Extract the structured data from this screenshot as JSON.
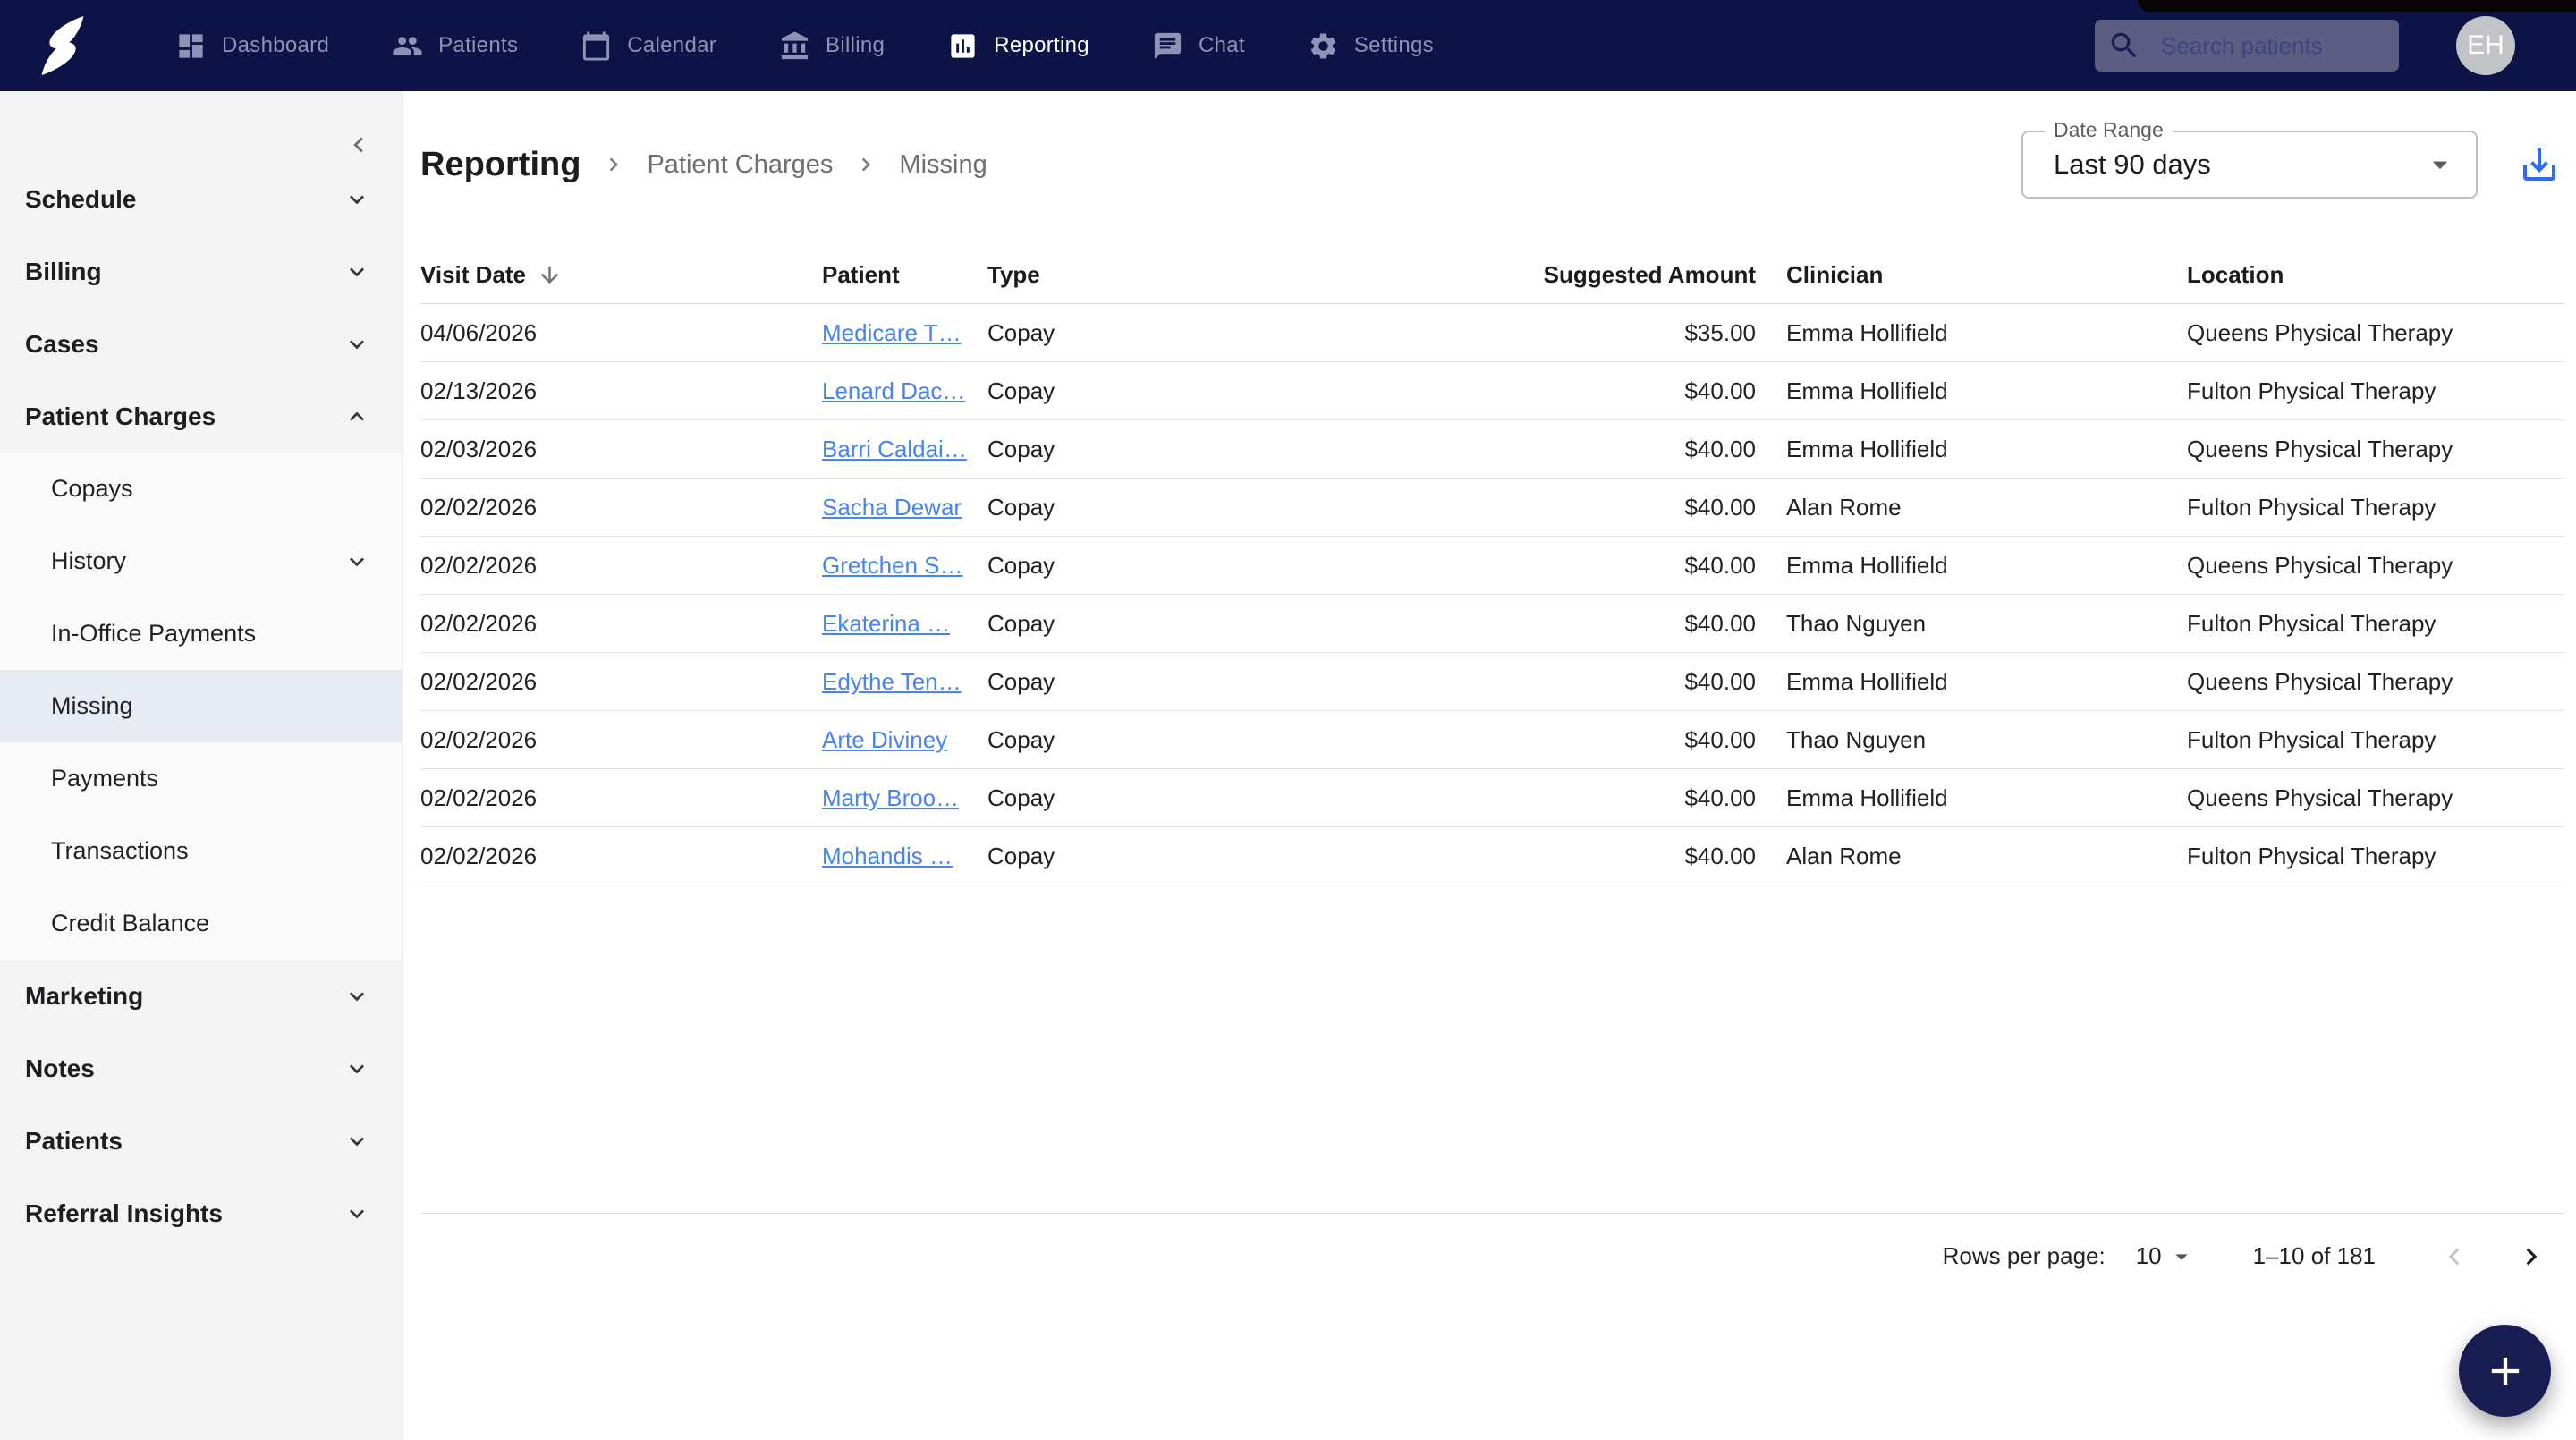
{
  "colors": {
    "navbar-bg": "#0e1347",
    "link-blue": "#4683f4",
    "download-blue": "#2a6cf5",
    "fab-bg": "#191e52",
    "selected-bg": "#e7ebf3"
  },
  "app": {
    "logo_name": "brand-s-logo",
    "nav": [
      {
        "label": "Dashboard",
        "icon": "dashboard-icon",
        "active": false
      },
      {
        "label": "Patients",
        "icon": "patients-icon",
        "active": false
      },
      {
        "label": "Calendar",
        "icon": "calendar-icon",
        "active": false
      },
      {
        "label": "Billing",
        "icon": "billing-icon",
        "active": false
      },
      {
        "label": "Reporting",
        "icon": "reporting-icon",
        "active": true
      },
      {
        "label": "Chat",
        "icon": "chat-icon",
        "active": false
      },
      {
        "label": "Settings",
        "icon": "settings-icon",
        "active": false
      }
    ],
    "search_placeholder": "Search patients",
    "avatar_initials": "EH"
  },
  "sidebar": {
    "items": [
      {
        "label": "Schedule",
        "type": "top",
        "chevron": "down"
      },
      {
        "label": "Billing",
        "type": "top",
        "chevron": "down"
      },
      {
        "label": "Cases",
        "type": "top",
        "chevron": "down"
      },
      {
        "label": "Patient Charges",
        "type": "top",
        "chevron": "up"
      },
      {
        "label": "Copays",
        "type": "sub",
        "chevron": ""
      },
      {
        "label": "History",
        "type": "sub",
        "chevron": "down"
      },
      {
        "label": "In-Office Payments",
        "type": "sub",
        "chevron": ""
      },
      {
        "label": "Missing",
        "type": "sub",
        "chevron": "",
        "selected": true
      },
      {
        "label": "Payments",
        "type": "sub",
        "chevron": ""
      },
      {
        "label": "Transactions",
        "type": "sub",
        "chevron": ""
      },
      {
        "label": "Credit Balance",
        "type": "sub",
        "chevron": ""
      },
      {
        "label": "Marketing",
        "type": "top",
        "chevron": "down"
      },
      {
        "label": "Notes",
        "type": "top",
        "chevron": "down"
      },
      {
        "label": "Patients",
        "type": "top",
        "chevron": "down"
      },
      {
        "label": "Referral Insights",
        "type": "top",
        "chevron": "down"
      }
    ]
  },
  "breadcrumb": [
    "Reporting",
    "Patient Charges",
    "Missing"
  ],
  "toolbar": {
    "date_range_label": "Date Range",
    "date_range_value": "Last 90 days"
  },
  "table": {
    "columns": [
      "Visit Date",
      "Patient",
      "Type",
      "Suggested Amount",
      "Clinician",
      "Location"
    ],
    "sorted_column": "Visit Date",
    "sort_direction": "desc",
    "rows": [
      {
        "visit_date": "04/06/2026",
        "patient": "Medicare T…",
        "type": "Copay",
        "amount": "$35.00",
        "clinician": "Emma Hollifield",
        "location": "Queens Physical Therapy"
      },
      {
        "visit_date": "02/13/2026",
        "patient": "Lenard Dac…",
        "type": "Copay",
        "amount": "$40.00",
        "clinician": "Emma Hollifield",
        "location": "Fulton Physical Therapy"
      },
      {
        "visit_date": "02/03/2026",
        "patient": "Barri Caldai…",
        "type": "Copay",
        "amount": "$40.00",
        "clinician": "Emma Hollifield",
        "location": "Queens Physical Therapy"
      },
      {
        "visit_date": "02/02/2026",
        "patient": "Sacha Dewar",
        "type": "Copay",
        "amount": "$40.00",
        "clinician": "Alan Rome",
        "location": "Fulton Physical Therapy"
      },
      {
        "visit_date": "02/02/2026",
        "patient": "Gretchen S…",
        "type": "Copay",
        "amount": "$40.00",
        "clinician": "Emma Hollifield",
        "location": "Queens Physical Therapy"
      },
      {
        "visit_date": "02/02/2026",
        "patient": "Ekaterina …",
        "type": "Copay",
        "amount": "$40.00",
        "clinician": "Thao Nguyen",
        "location": "Fulton Physical Therapy"
      },
      {
        "visit_date": "02/02/2026",
        "patient": "Edythe Ten…",
        "type": "Copay",
        "amount": "$40.00",
        "clinician": "Emma Hollifield",
        "location": "Queens Physical Therapy"
      },
      {
        "visit_date": "02/02/2026",
        "patient": "Arte Diviney",
        "type": "Copay",
        "amount": "$40.00",
        "clinician": "Thao Nguyen",
        "location": "Fulton Physical Therapy"
      },
      {
        "visit_date": "02/02/2026",
        "patient": "Marty Broo…",
        "type": "Copay",
        "amount": "$40.00",
        "clinician": "Emma Hollifield",
        "location": "Queens Physical Therapy"
      },
      {
        "visit_date": "02/02/2026",
        "patient": "Mohandis …",
        "type": "Copay",
        "amount": "$40.00",
        "clinician": "Alan Rome",
        "location": "Fulton Physical Therapy"
      }
    ]
  },
  "pagination": {
    "rows_per_page_label": "Rows per page:",
    "rows_per_page": "10",
    "range": "1–10 of 181"
  },
  "fab": {
    "plus_label": "add"
  }
}
